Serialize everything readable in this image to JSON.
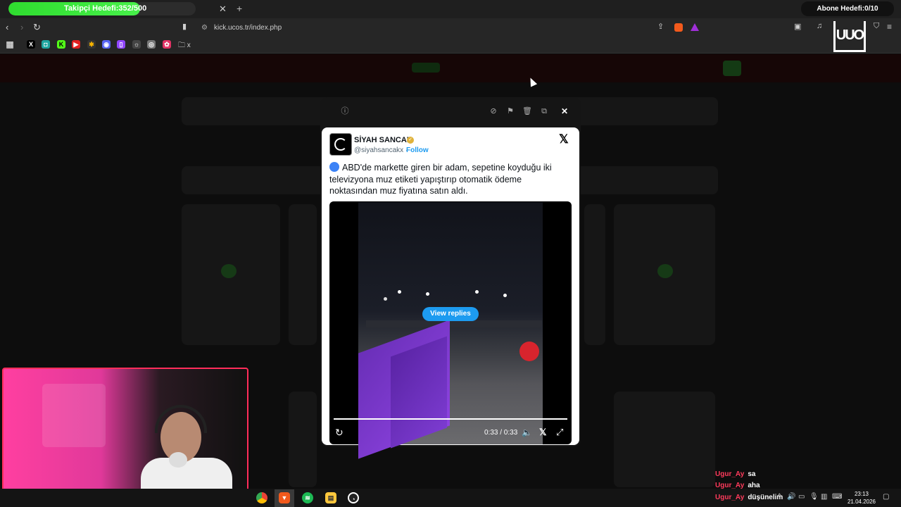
{
  "browser": {
    "tab_label": "Takipçi Hedefi:352/500",
    "tab_progress_percent": 70.4,
    "url": "kick.ucos.tr/index.php",
    "abone_label": "Abone Hedefi:0/10",
    "bookmark_folder_label": "x"
  },
  "modal": {
    "author_name": "SİYAH SANCAK",
    "author_handle": "@siyahsancakx",
    "separator": "·",
    "follow_label": "Follow",
    "tweet_text": "ABD'de markette giren bir adam, sepetine koyduğu iki televizyona muz etiketi yapıştırıp otomatik ödeme noktasından muz fiyatına satın aldı.",
    "view_replies_label": "View replies",
    "video_time": "0:33 / 0:33",
    "video_progress_percent": 100
  },
  "chat": [
    {
      "name": "Ugur_Ay",
      "message": "sa"
    },
    {
      "name": "Ugur_Ay",
      "message": "aha"
    },
    {
      "name": "Ugur_Ay",
      "message": "düşünelim"
    }
  ],
  "taskbar": {
    "time": "23:13",
    "date": "21.04.2026"
  },
  "colors": {
    "accent_green": "#2fdc2f",
    "twitter_blue": "#1d9bf0",
    "cam_border": "#ff2d5a",
    "chat_name": "#ff3b5c"
  }
}
